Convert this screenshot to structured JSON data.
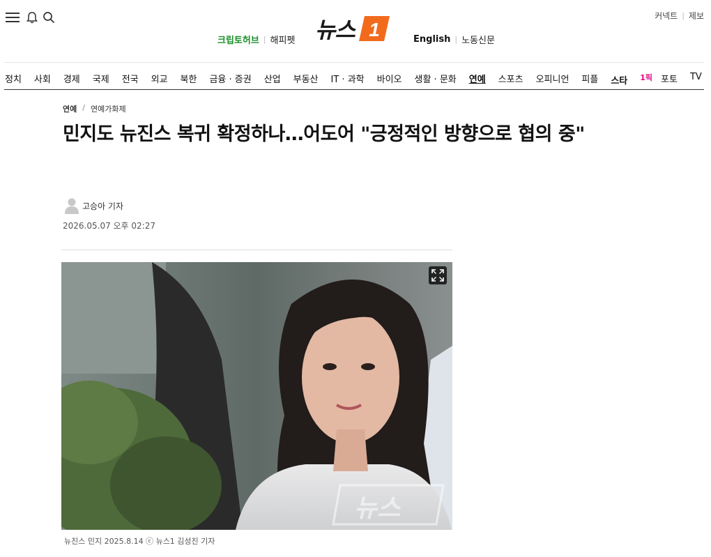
{
  "header": {
    "logo_text": "뉴스",
    "logo_mark_number": "1",
    "top_links": [
      "커넥트",
      "제보"
    ],
    "sub_left": [
      "크립토허브",
      "해피펫"
    ],
    "sub_right": [
      "English",
      "노동신문"
    ]
  },
  "nav": {
    "items": [
      "정치",
      "사회",
      "경제",
      "국제",
      "전국",
      "외교",
      "북한",
      "금융 · 증권",
      "산업",
      "부동산",
      "IT · 과학",
      "바이오",
      "생활 · 문화",
      "연예",
      "스포츠",
      "오피니언",
      "피플",
      "스타",
      "포토",
      "TV"
    ],
    "active": "연예",
    "star_suffix": "1픽"
  },
  "article": {
    "category": "연예",
    "subcategory": "연예가화제",
    "separator": "/",
    "title": "민지도 뉴진스 복귀 확정하나…어도어 \"긍정적인 방향으로 협의 중\"",
    "reporter": "고승아 기자",
    "date": "2026.05.07 오후 02:27",
    "photo_caption": "뉴진스 민지 2025.8.14 ⓒ 뉴스1 김성진 기자",
    "watermark": "뉴스"
  },
  "colors": {
    "brand_orange": "#f26b1d",
    "green": "#1a8f2a",
    "star_pink": "#e6007e"
  }
}
